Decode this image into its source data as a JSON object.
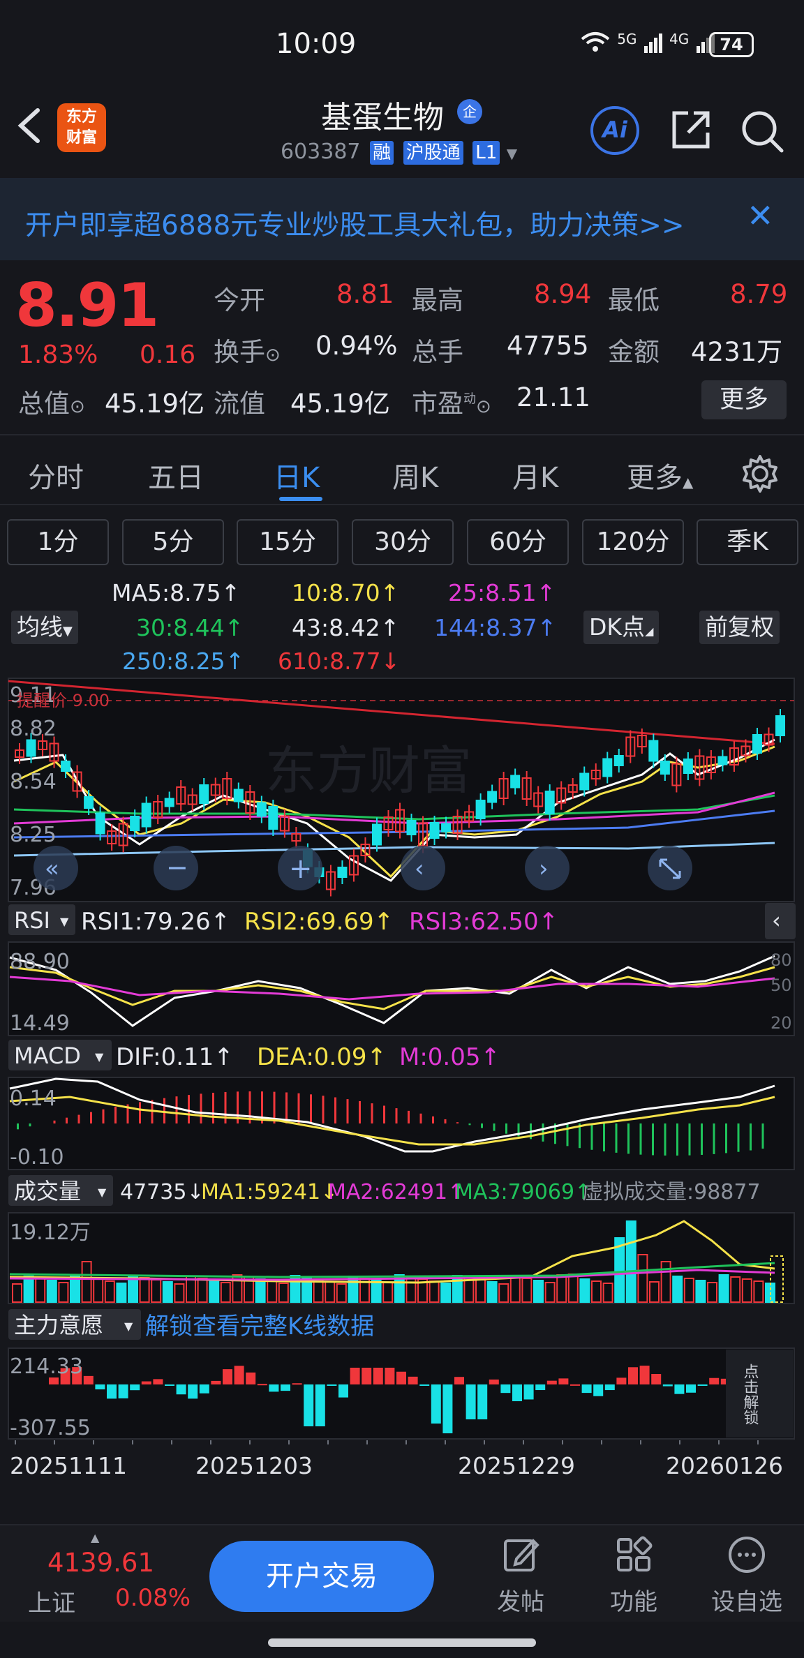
{
  "status_bar": {
    "time": "10:09",
    "network1": "5G",
    "network2": "4G",
    "battery": "74"
  },
  "header": {
    "stock_name": "基蛋生物",
    "badge": "企",
    "code": "603387",
    "tags": [
      "融",
      "沪股通",
      "L1"
    ],
    "logo_line1": "东方",
    "logo_line2": "财富",
    "ai_label": "Ai"
  },
  "banner": {
    "text": "开户即享超6888元专业炒股工具大礼包，助力决策>>"
  },
  "quote": {
    "price": "8.91",
    "change_pct": "1.83%",
    "change_amt": "0.16",
    "rows": [
      [
        {
          "label": "今开",
          "value": "8.81"
        },
        {
          "label": "最高",
          "value": "8.94"
        },
        {
          "label": "最低",
          "value": "8.79"
        }
      ],
      [
        {
          "label": "换手",
          "value": "0.94%"
        },
        {
          "label": "总手",
          "value": "47755"
        },
        {
          "label": "金额",
          "value": "4231万"
        }
      ],
      [
        {
          "label": "总值",
          "value": "45.19亿"
        },
        {
          "label": "流值",
          "value": "45.19亿"
        },
        {
          "label": "市盈",
          "value": "21.11"
        }
      ]
    ],
    "pe_superscript": "动",
    "more": "更多"
  },
  "period_tabs": [
    "分时",
    "五日",
    "日K",
    "周K",
    "月K",
    "更多"
  ],
  "minute_tabs": [
    "1分",
    "5分",
    "15分",
    "30分",
    "60分",
    "120分",
    "季K"
  ],
  "ma": {
    "ma_button": "均线",
    "ma5": "MA5:8.75↑",
    "ma10": "10:8.70↑",
    "ma25": "25:8.51↑",
    "ma30": "30:8.44↑",
    "ma43": "43:8.42↑",
    "ma144": "144:8.37↑",
    "ma250": "250:8.25↑",
    "ma610": "610:8.77↓",
    "dk_button": "DK点",
    "adjust_button": "前复权"
  },
  "kline": {
    "y_labels": [
      "9.11",
      "8.82",
      "8.54",
      "8.25",
      "7.96"
    ],
    "alert_label": "提醒价 9.00",
    "watermark": "东方财富"
  },
  "rsi": {
    "name": "RSI",
    "rsi1": "RSI1:79.26↑",
    "rsi2": "RSI2:69.69↑",
    "rsi3": "RSI3:62.50↑",
    "y_top": "88.90",
    "y_bottom": "14.49",
    "r80": "80",
    "r50": "50",
    "r20": "20"
  },
  "macd": {
    "name": "MACD",
    "dif": "DIF:0.11↑",
    "dea": "DEA:0.09↑",
    "m": "M:0.05↑",
    "y_top": "0.14",
    "y_bottom": "-0.10"
  },
  "volume": {
    "name": "成交量",
    "vol": "47735↓",
    "ma1": "MA1:59241↓",
    "ma2": "MA2:62491↑",
    "ma3": "MA3:79069↑",
    "virtual": "虚拟成交量:98877",
    "y_top": "19.12万"
  },
  "main_force": {
    "name": "主力意愿",
    "unlock_text": "解锁查看完整K线数据",
    "y_top": "214.33",
    "y_bottom": "-307.55",
    "side_unlock": "点击解锁"
  },
  "dates": [
    "20251111",
    "20251203",
    "20251229",
    "20260126"
  ],
  "bottom_bar": {
    "index_value": "4139.61",
    "index_name": "上证",
    "index_pct": "0.08%",
    "trade_button": "开户交易",
    "nav": [
      {
        "label": "发帖",
        "icon": "edit-icon"
      },
      {
        "label": "功能",
        "icon": "grid-icon"
      },
      {
        "label": "设自选",
        "icon": "more-dots-icon"
      }
    ]
  },
  "colors": {
    "up": "#f0373b",
    "down": "#19e1e6",
    "accent": "#2f7cf0",
    "background": "#16171c"
  }
}
